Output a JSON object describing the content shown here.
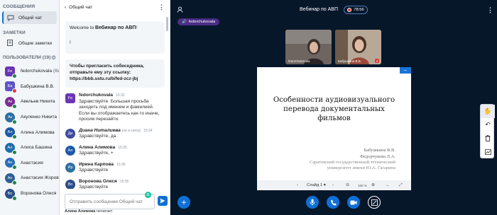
{
  "sidebar": {
    "messages_title": "СООБЩЕНИЯ",
    "public_chat_label": "Общий чат",
    "notes_title": "ЗАМЕТКИ",
    "shared_notes_label": "Общие заметки",
    "users_title": "ПОЛЬЗОВАТЕЛИ (19)",
    "users": [
      {
        "initials": "Fe",
        "name": "fedorchukovala",
        "you": "(Вы)",
        "color": "#6b35b5",
        "shape": "square",
        "dot": "#1f8a3e"
      },
      {
        "initials": "Ба",
        "name": "Бабушкина В.В.",
        "color": "#5e53c7",
        "shape": "square",
        "dot": "#d93b3b"
      },
      {
        "initials": "Ак",
        "name": "Авельев Никита",
        "color": "#7b2c91",
        "shape": "round",
        "dot": "#1f8a3e"
      },
      {
        "initials": "Ак",
        "name": "Акуленко Никита",
        "color": "#2c6fa3",
        "shape": "round",
        "dot": "#1f8a3e"
      },
      {
        "initials": "Ал",
        "name": "Алина Алимова",
        "color": "#1d5aa8",
        "shape": "round",
        "dot": "#1f8a3e"
      },
      {
        "initials": "Ал",
        "name": "Алиса Башина",
        "color": "#1e6cad",
        "shape": "round",
        "dot": "#1f8a3e"
      },
      {
        "initials": "Ан",
        "name": "Анастасия",
        "color": "#2a6cb8",
        "shape": "round",
        "dot": "#1f8a3e"
      },
      {
        "initials": "Ан",
        "name": "Анастасия Жорова",
        "color": "#2d5f93",
        "shape": "round",
        "dot": "#1f8a3e"
      },
      {
        "initials": "Во",
        "name": "Воронова Олеся",
        "color": "#2a4f8a",
        "shape": "round",
        "dot": "#1f8a3e"
      }
    ]
  },
  "chat": {
    "header_back": "Общий чат",
    "welcome_prefix": "Welcome to ",
    "welcome_bold": "Вебинар по АВП",
    "welcome_suffix": "!",
    "welcome_extra": "!",
    "invite_text": "Чтобы пригласить собеседника, отправьте ему эту ссылку:",
    "invite_link": "https://bbb.sstu.ru/b/fed-zcz-jbj",
    "messages": [
      {
        "initials": "Fe",
        "color": "#6b35b5",
        "shape": "square",
        "name": "fedorchukovala",
        "time": "15:32",
        "offline": "",
        "italic": false,
        "text": "Здравствуйте. Большая просьба заходить под именем и фамилией. Если вы отображаетесь как-то иначе, просим перезайти."
      },
      {
        "initials": "Ди",
        "color": "#3c4a9e",
        "shape": "round",
        "name": "Диана Ниталиева",
        "time": "15:34",
        "offline": "(не в сети)",
        "italic": true,
        "text": "Здравствуйте, да"
      },
      {
        "initials": "Ал",
        "color": "#1d5aa8",
        "shape": "round",
        "name": "Алина Алимова",
        "time": "15:35",
        "offline": "",
        "italic": false,
        "text": "Здравствуйте, +"
      },
      {
        "initials": "Ир",
        "color": "#2c6fa3",
        "shape": "round",
        "name": "Ирина Карпова",
        "time": "15:35",
        "offline": "",
        "italic": false,
        "text": "Здравствуйте"
      },
      {
        "initials": "Во",
        "color": "#2a4f8a",
        "shape": "round",
        "name": "Воронова Олеся",
        "time": "15:35",
        "offline": "",
        "italic": false,
        "text": "Здравствуйте"
      }
    ],
    "input_placeholder": "Отправить сообщение Общий чат",
    "typing_name": "Алина Алимова",
    "typing_suffix": " печатает"
  },
  "main": {
    "title": "Вебинар по АВП",
    "recording_time": "78:56",
    "talking_user": "fedorchukovala",
    "cameras": [
      {
        "label": "fedorchukovala",
        "bg": "#6a5a50"
      },
      {
        "label": "Бабушкина В.В.",
        "bg": "#8a7a6a"
      }
    ],
    "slide": {
      "title_lines": [
        "Особенности аудиовизуального",
        "перевода документальных",
        "фильмов"
      ],
      "author1": "Бабушкина В.В.",
      "author2": "Федорчукова Л.А.",
      "org1": "Саратовский государственный технический",
      "org2": "университет имени Ю.А. Гагарина",
      "slide_select": "Слайд 1",
      "zoom": "100 %"
    }
  },
  "colors": {
    "accent": "#0f70d7",
    "main_bg": "#06172a",
    "recording": "#e03434"
  }
}
